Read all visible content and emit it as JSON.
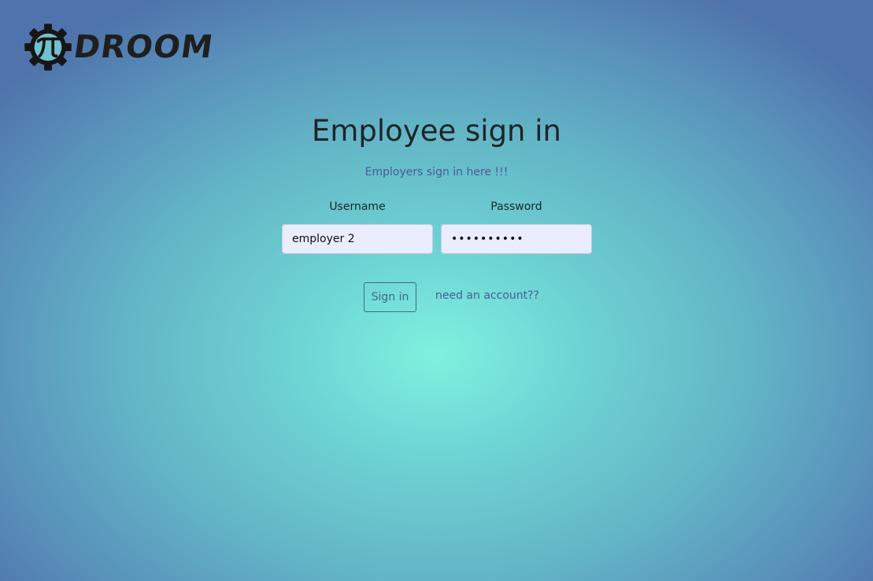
{
  "brand": {
    "logo_icon": "pi-gear-icon",
    "logo_text": "DROOM"
  },
  "heading": {
    "title": "Employee sign in",
    "employer_link": "Employers sign in here !!!"
  },
  "form": {
    "username_label": "Username",
    "username_value": "employer 2",
    "password_label": "Password",
    "password_value": "••••••••••",
    "signin_label": "Sign in",
    "account_link": "need an account??"
  },
  "colors": {
    "background_center": "#7ff1df",
    "background_edge": "#4f74ab",
    "link": "#4a5a9a",
    "button_border": "#3d6a86",
    "input_bg": "#e9edfd"
  }
}
